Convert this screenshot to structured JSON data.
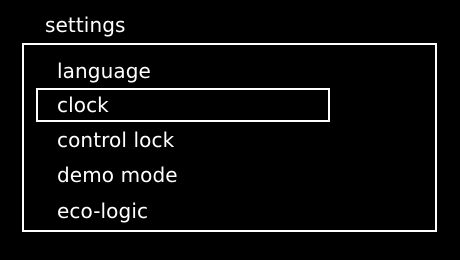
{
  "header": {
    "title": "settings"
  },
  "menu": {
    "selected_index": 1,
    "items": [
      {
        "label": "language"
      },
      {
        "label": "clock"
      },
      {
        "label": "control lock"
      },
      {
        "label": "demo mode"
      },
      {
        "label": "eco-logic"
      }
    ]
  },
  "colors": {
    "background": "#000000",
    "foreground": "#ffffff"
  }
}
